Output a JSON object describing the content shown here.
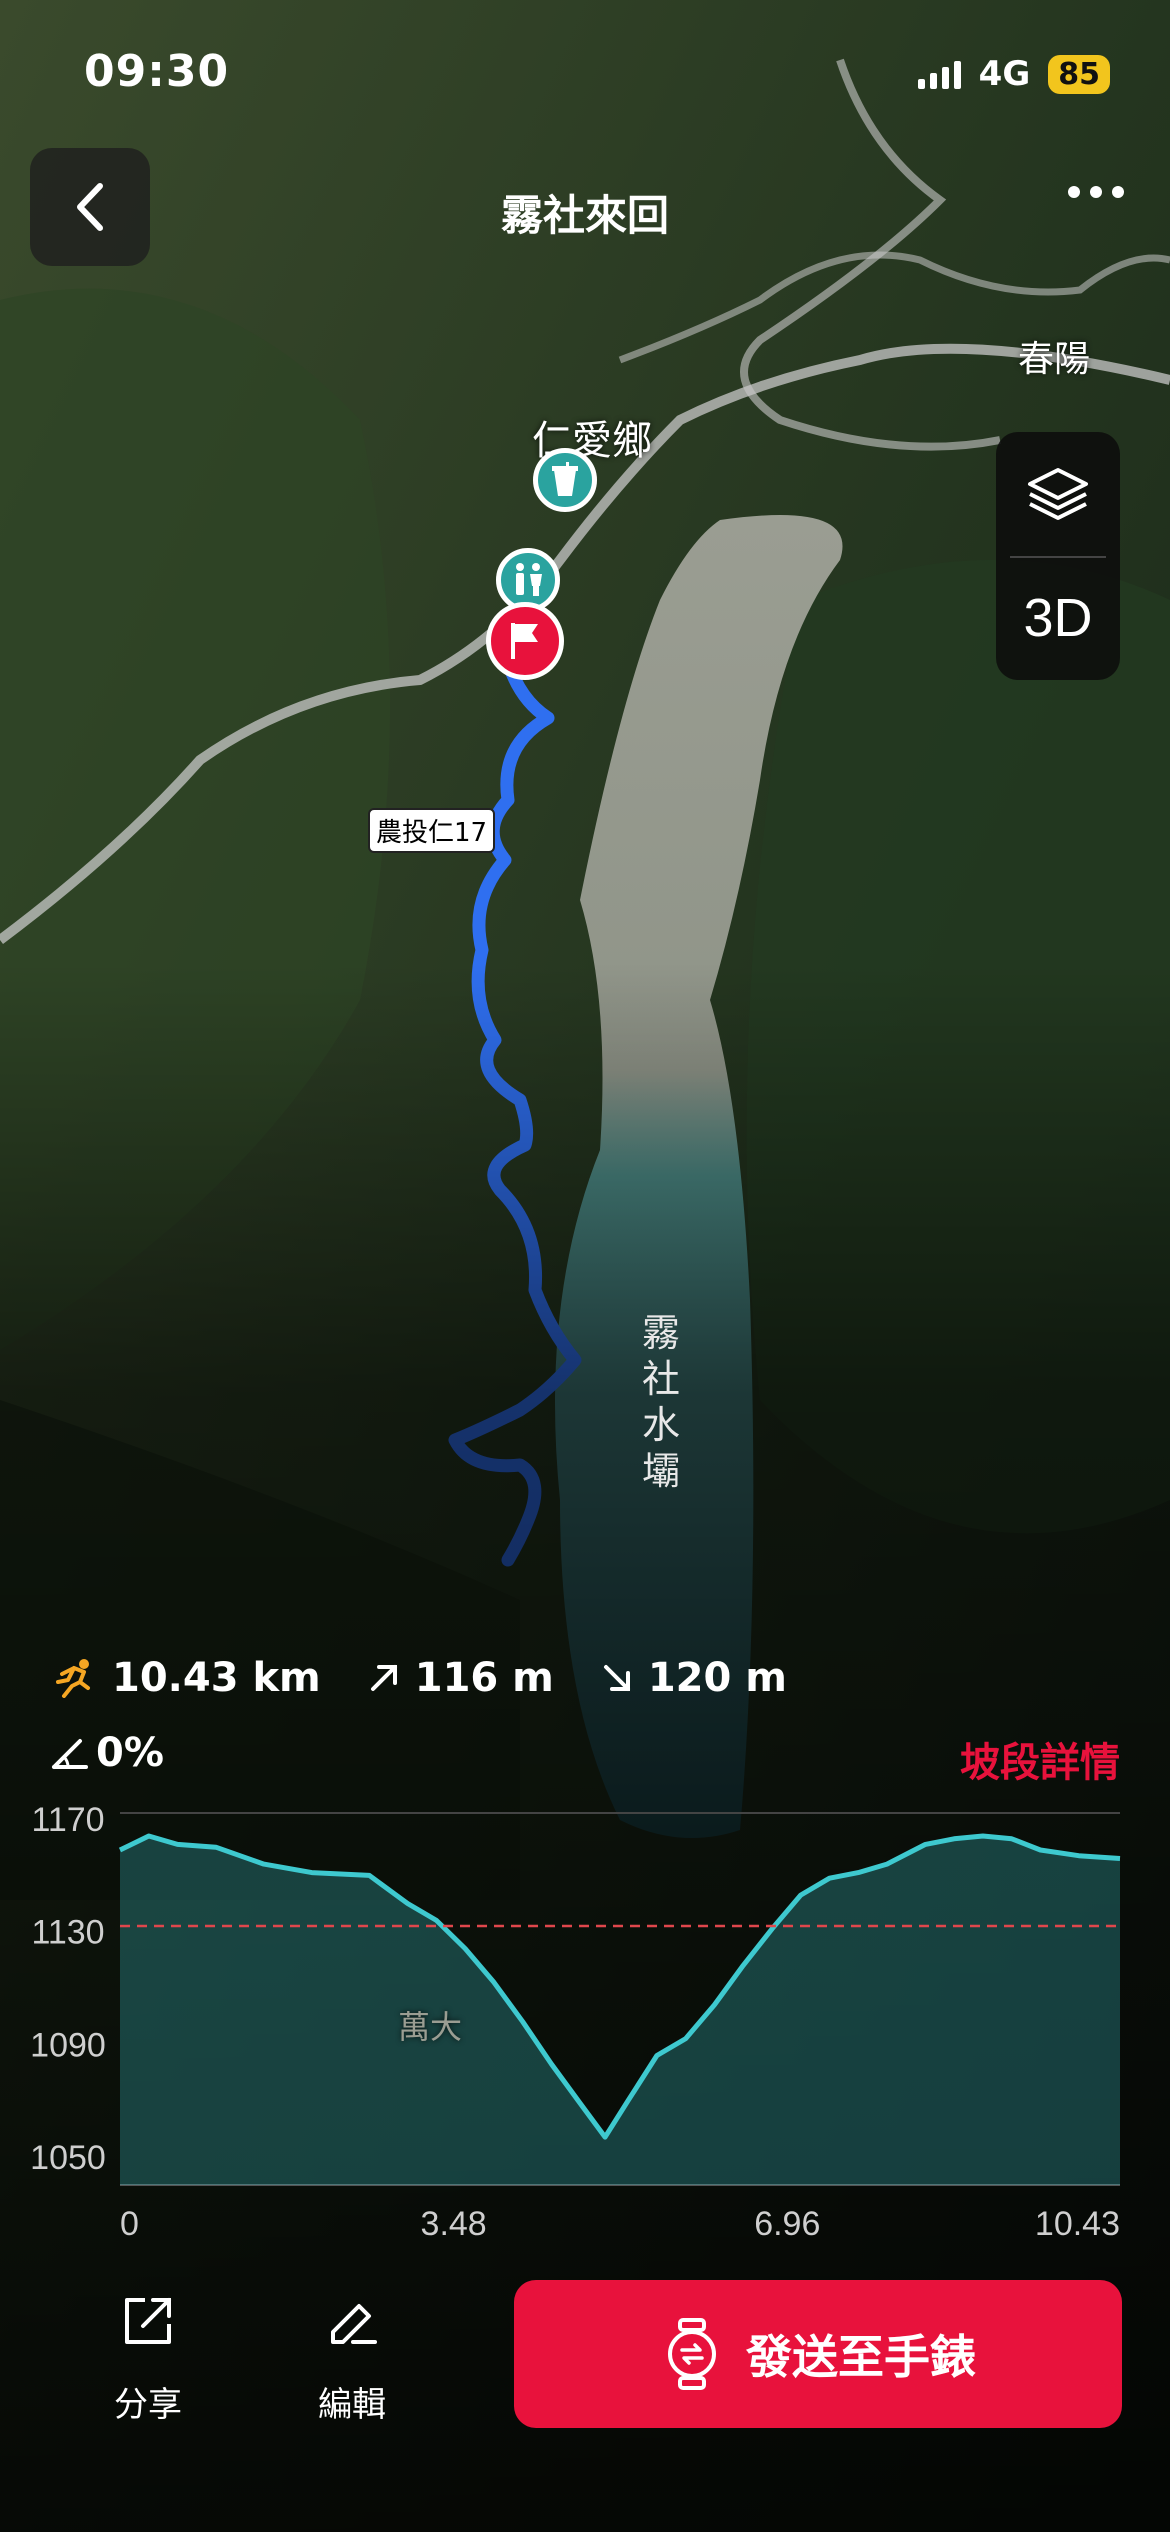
{
  "status_bar": {
    "time": "09:30",
    "network": "4G",
    "battery": "85"
  },
  "header": {
    "title": "霧社來回"
  },
  "map": {
    "labels": {
      "town": "仁愛鄉",
      "village": "春陽",
      "road": "農投仁17",
      "reservoir": "霧社水壩",
      "area": "萬大"
    },
    "view_mode": "3D",
    "route_color": "#2f6ff0"
  },
  "stats": {
    "distance": "10.43 km",
    "ascent": "116 m",
    "descent": "120 m",
    "grade": "0%",
    "slope_link": "坡段詳情"
  },
  "chart_data": {
    "type": "area",
    "x_ticks": [
      "0",
      "3.48",
      "6.96",
      "10.43"
    ],
    "y_ticks": [
      "1170",
      "1130",
      "1090",
      "1050"
    ],
    "xlim": [
      0,
      10.43
    ],
    "ylim": [
      1040,
      1175
    ],
    "avg_line": 1132,
    "series": [
      {
        "x": [
          0,
          0.3,
          0.6,
          1.0,
          1.5,
          2.0,
          2.6,
          3.0,
          3.3,
          3.6,
          3.9,
          4.2,
          4.5,
          4.8,
          5.06,
          5.3,
          5.6,
          5.9,
          6.2,
          6.5,
          6.8,
          7.1,
          7.4,
          7.7,
          8.0,
          8.4,
          8.7,
          9.0,
          9.3,
          9.6,
          10.0,
          10.43
        ],
        "y": [
          1159,
          1164,
          1161,
          1160,
          1154,
          1151,
          1150,
          1140,
          1134,
          1124,
          1112,
          1098,
          1083,
          1069,
          1057,
          1070,
          1086,
          1092,
          1104,
          1118,
          1131,
          1143,
          1149,
          1151,
          1154,
          1161,
          1163,
          1164,
          1163,
          1159,
          1157,
          1156
        ]
      }
    ],
    "line_color": "#3ec9cf",
    "avg_color": "#e0474c"
  },
  "actions": {
    "share": "分享",
    "edit": "編輯",
    "send": "發送至手錶"
  }
}
